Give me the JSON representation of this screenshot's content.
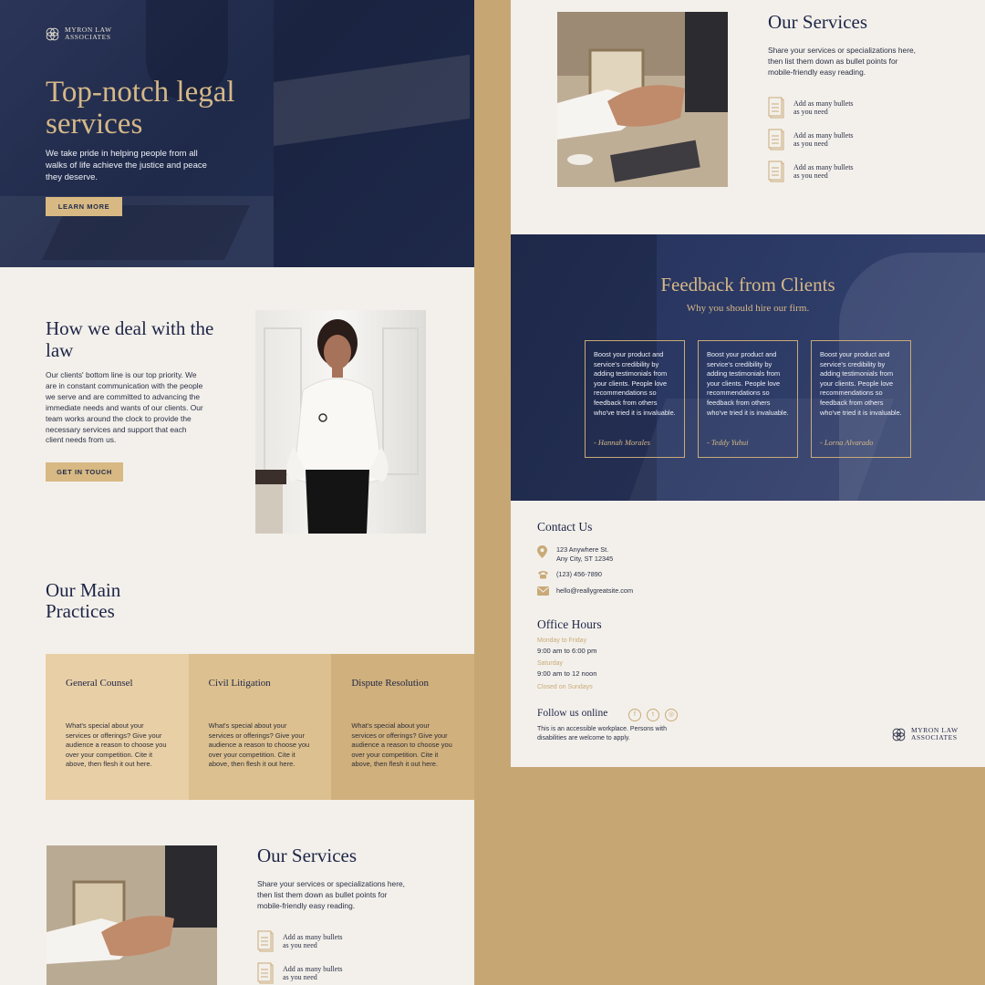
{
  "brand": {
    "name_line1": "MYRON LAW",
    "name_line2": "ASSOCIATES"
  },
  "hero": {
    "title": "Top-notch legal services",
    "text": "We take pride in helping people from all walks of life achieve the justice and peace they deserve.",
    "button": "LEARN MORE"
  },
  "deal": {
    "title": "How we deal with the law",
    "text": "Our clients' bottom line is our top priority. We are in constant communication with the people we serve and are committed to advancing the immediate needs and wants of our clients. Our team works around the clock to provide the necessary services and support that each client needs from us.",
    "button": "GET IN TOUCH"
  },
  "practices": {
    "title": "Our Main Practices",
    "items": [
      {
        "title": "General Counsel",
        "text": "What's special about your services or offerings? Give your audience a reason to choose you over your competition. Cite it above, then flesh it out here."
      },
      {
        "title": "Civil Litigation",
        "text": "What's special about your services or offerings? Give your audience a reason to choose you over your competition. Cite it above, then flesh it out here."
      },
      {
        "title": "Dispute Resolution",
        "text": "What's special about your services or offerings? Give your audience a reason to choose you over your competition. Cite it above, then flesh it out here."
      }
    ],
    "colors": [
      "#e8cfa6",
      "#dcc08f",
      "#d0b07c"
    ]
  },
  "services": {
    "title": "Our Services",
    "text": "Share your services or specializations here, then list them down as bullet points for mobile-friendly easy reading.",
    "bullets": [
      {
        "line1": "Add as many bullets",
        "line2": "as you need",
        "icon": "document-icon"
      },
      {
        "line1": "Add as many bullets",
        "line2": "as you need",
        "icon": "document-icon"
      },
      {
        "line1": "Add as many bullets",
        "line2": "as you need",
        "icon": "document-icon"
      }
    ]
  },
  "feedback": {
    "title": "Feedback from Clients",
    "subtitle": "Why you should hire our firm.",
    "items": [
      {
        "text": "Boost your product and service's credibility by adding testimonials from your clients. People love recommendations so feedback from others who've tried it is invaluable.",
        "name": "- Hannah Morales"
      },
      {
        "text": "Boost your product and service's credibility by adding testimonials from your clients. People love recommendations so feedback from others who've tried it is invaluable.",
        "name": "- Teddy Yuhui"
      },
      {
        "text": "Boost your product and service's credibility by adding testimonials from your clients. People love recommendations so feedback from others who've tried it is invaluable.",
        "name": "- Lorna Alvarado"
      }
    ]
  },
  "contact": {
    "title": "Contact Us",
    "address_line1": "123 Anywhere St.",
    "address_line2": "Any City, ST 12345",
    "phone": "(123) 456-7890",
    "email": "hello@reallygreatsite.com"
  },
  "hours": {
    "title": "Office Hours",
    "weekday_label": "Monday to Friday",
    "weekday_hours": "9:00 am to 6:00 pm",
    "saturday_label": "Saturday",
    "saturday_hours": "9:00 am to 12 noon",
    "sunday_label": "Closed on Sundays"
  },
  "follow": {
    "title": "Follow us online",
    "note": "This is an accessible workplace. Persons with disabilities are welcome to apply.",
    "icons": [
      "facebook-icon",
      "twitter-icon",
      "instagram-icon"
    ]
  },
  "colors": {
    "navy": "#1f2a4a",
    "gold": "#d6b888",
    "cream": "#f3f0eb",
    "tan": "#c6a774"
  }
}
